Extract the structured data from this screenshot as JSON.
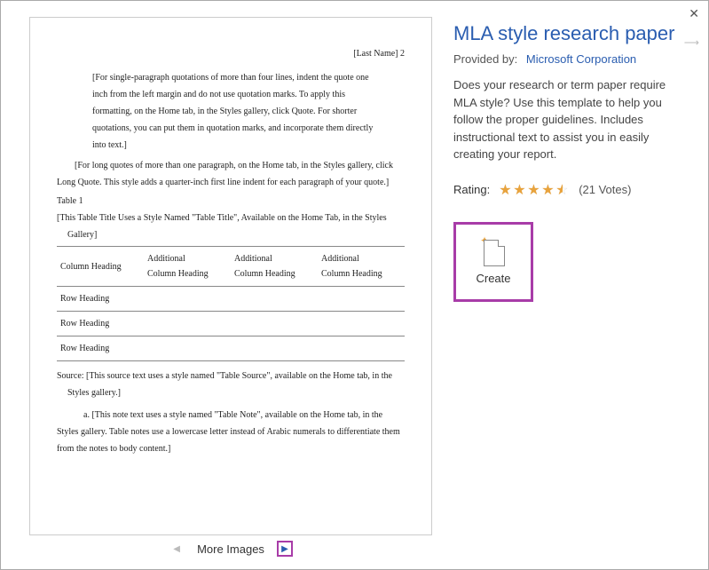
{
  "preview": {
    "header": "[Last Name] 2",
    "p1_l1": "[For single-paragraph quotations of more than four lines, indent the quote one",
    "p1_l2": "inch from the left margin and do not use quotation marks. To apply this",
    "p1_l3": "formatting, on the Home tab, in the Styles gallery, click Quote. For shorter",
    "p1_l4": "quotations, you can put them in quotation marks, and incorporate them directly",
    "p1_l5": "into text.]",
    "p2_l1": "[For long quotes of more than one paragraph, on the Home tab, in the Styles gallery, click",
    "p2_l2": "Long Quote. This style adds a quarter-inch first line indent for each paragraph of your quote.]",
    "table_label": "Table 1",
    "table_title_l1": "[This Table Title Uses a Style Named \"Table Title\", Available on the Home Tab, in the Styles",
    "table_title_l2": "Gallery]",
    "col1": "Column Heading",
    "col2a": "Additional",
    "col2b": "Column Heading",
    "row": "Row Heading",
    "source_l1": "Source: [This source text uses a style named \"Table Source\", available on the Home tab, in the",
    "source_l2": "Styles gallery.]",
    "note_l1": "a. [This note text uses a style named \"Table Note\", available on the Home tab, in the",
    "note_l2": "Styles gallery. Table notes use a lowercase letter instead of Arabic numerals to differentiate them",
    "note_l3": "from the notes to body content.]"
  },
  "nav": {
    "label": "More Images"
  },
  "details": {
    "title": "MLA style research paper",
    "provided_label": "Provided by:",
    "provider": "Microsoft Corporation",
    "description": "Does your research or term paper require MLA style? Use this template to help you follow the proper guidelines. Includes instructional text to assist you in easily creating your report.",
    "rating_label": "Rating:",
    "rating_value": 4.5,
    "votes": "(21 Votes)",
    "create_label": "Create"
  }
}
